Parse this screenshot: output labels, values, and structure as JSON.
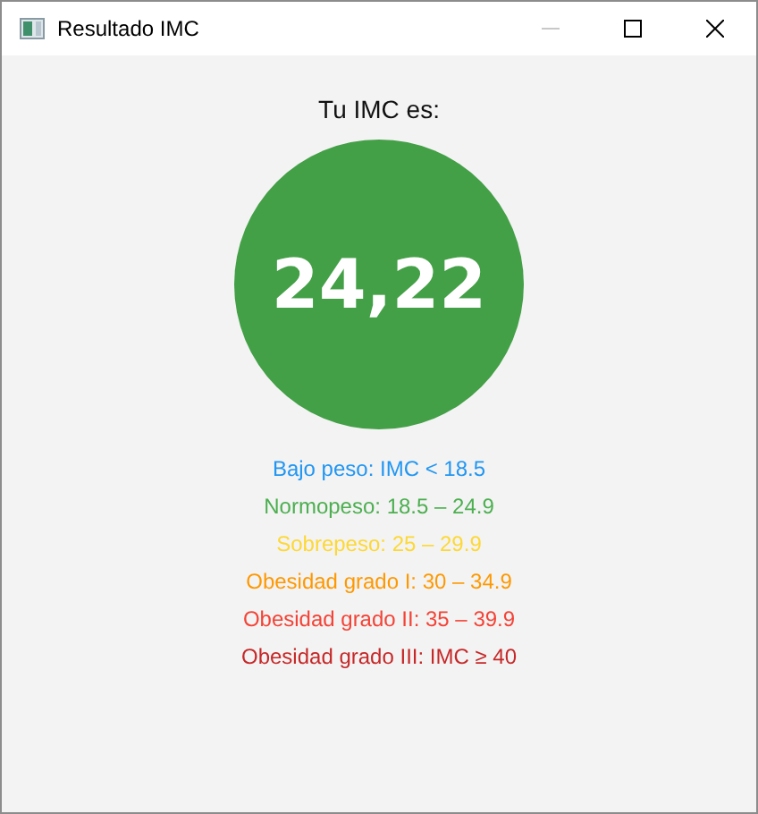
{
  "window": {
    "title": "Resultado IMC",
    "minimize_disabled": true
  },
  "heading": "Tu IMC es:",
  "bmi_value": "24,22",
  "categories": [
    {
      "label": "Bajo peso: IMC < 18.5",
      "color": "#2196f3"
    },
    {
      "label": "Normopeso: 18.5 – 24.9",
      "color": "#4caf50"
    },
    {
      "label": "Sobrepeso: 25 – 29.9",
      "color": "#fdd835"
    },
    {
      "label": "Obesidad grado I: 30 – 34.9",
      "color": "#ff9800"
    },
    {
      "label": "Obesidad grado II: 35 – 39.9",
      "color": "#f44336"
    },
    {
      "label": "Obesidad grado III: IMC ≥ 40",
      "color": "#c62828"
    }
  ]
}
